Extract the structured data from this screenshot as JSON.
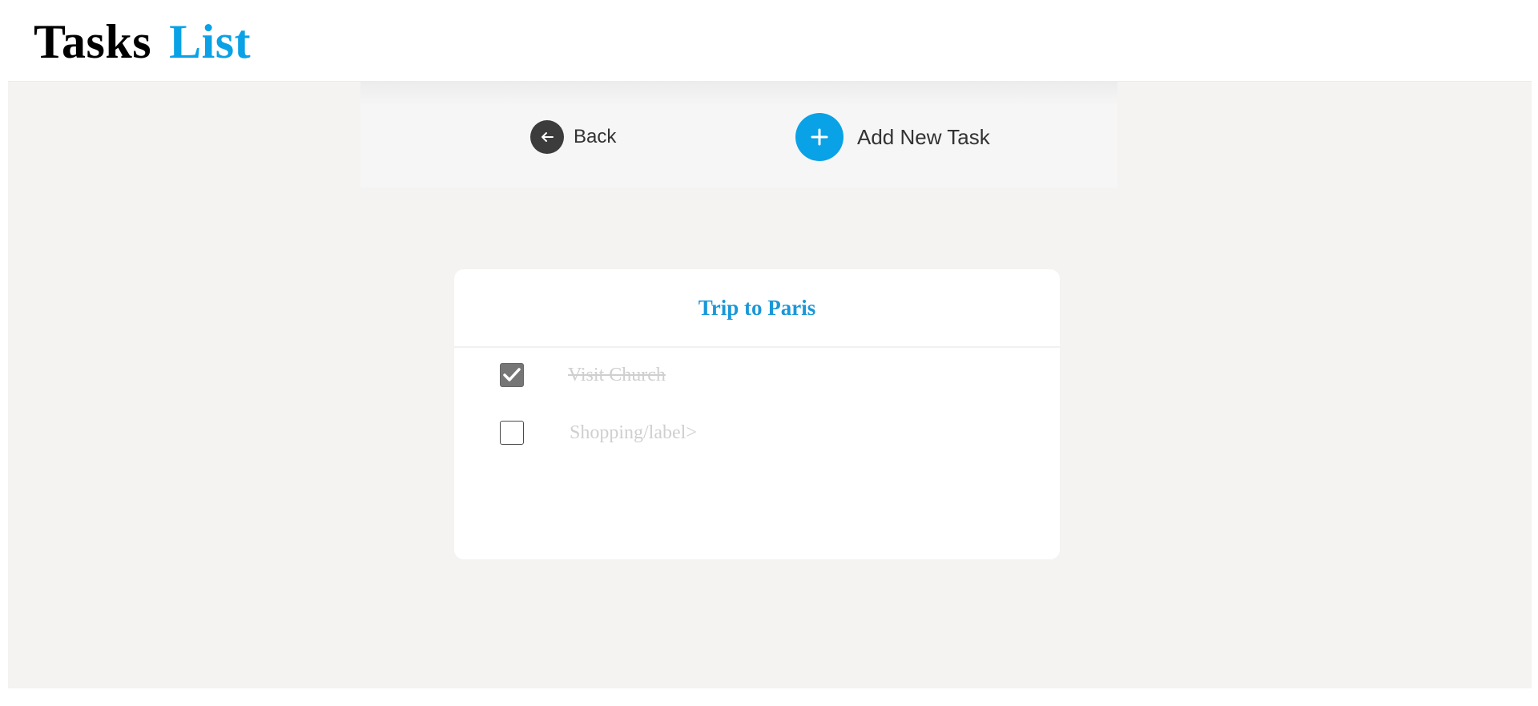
{
  "header": {
    "title_word_1": "Tasks",
    "title_word_2": "List"
  },
  "toolbar": {
    "back_label": "Back",
    "back_icon": "arrow-left-icon",
    "add_label": "Add New Task",
    "add_icon": "plus-icon"
  },
  "card": {
    "title": "Trip to Paris",
    "tasks": [
      {
        "label": "Visit Church",
        "checked": true
      },
      {
        "label": "Shopping/label>",
        "checked": false
      }
    ]
  },
  "colors": {
    "accent": "#0aa2e6",
    "workspace_bg": "#f4f3f2",
    "back_button": "#3c3c3c",
    "checked_box": "#767676",
    "task_text": "#cfcfcf"
  }
}
